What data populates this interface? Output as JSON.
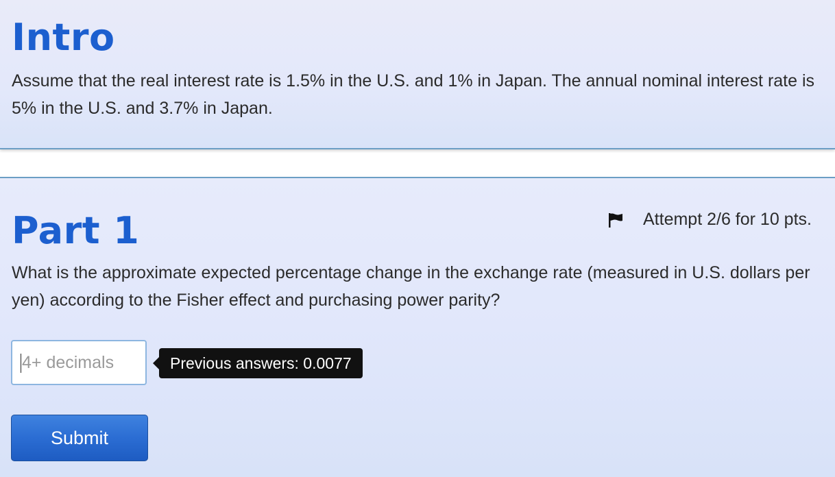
{
  "intro": {
    "title": "Intro",
    "text": "Assume that the real interest rate is 1.5% in the U.S. and 1% in Japan. The annual nominal interest rate is 5% in the U.S. and 3.7% in Japan."
  },
  "part1": {
    "title": "Part 1",
    "attempt": "Attempt 2/6 for 10 pts.",
    "question": "What is the approximate expected percentage change in the exchange rate (measured in U.S. dollars per yen) according to the Fisher effect and purchasing power parity?",
    "answer_input": {
      "value": "",
      "placeholder": "4+ decimals"
    },
    "tooltip": "Previous answers: 0.0077",
    "submit_label": "Submit"
  },
  "icons": {
    "flag": "flag-icon"
  },
  "colors": {
    "title_blue": "#1c5fcf",
    "panel_border": "#6b9ec4",
    "submit_blue": "#2b6dd3",
    "tooltip_bg": "#111111"
  }
}
